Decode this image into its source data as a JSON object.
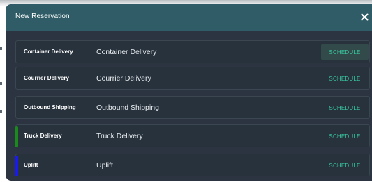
{
  "dialog": {
    "title": "New Reservation",
    "close_icon": "close-icon"
  },
  "reservation_types": [
    {
      "type": "Container Delivery",
      "name": "Container Delivery",
      "action": "SCHEDULE",
      "accent_color": "",
      "hovered": true
    },
    {
      "type": "Courrier Delivery",
      "name": "Courrier Delivery",
      "action": "SCHEDULE",
      "accent_color": "",
      "hovered": false
    },
    {
      "type": "Outbound Shipping",
      "name": "Outbound Shipping",
      "action": "SCHEDULE",
      "accent_color": "",
      "hovered": false
    },
    {
      "type": "Truck Delivery",
      "name": "Truck Delivery",
      "action": "SCHEDULE",
      "accent_color": "#1a8a1a",
      "hovered": false
    },
    {
      "type": "Uplift",
      "name": "Uplift",
      "action": "SCHEDULE",
      "accent_color": "#1a1aee",
      "hovered": false
    }
  ],
  "colors": {
    "header_bg": "#2f5c66",
    "body_bg": "#2b3440",
    "action_text": "#38c9a0"
  }
}
